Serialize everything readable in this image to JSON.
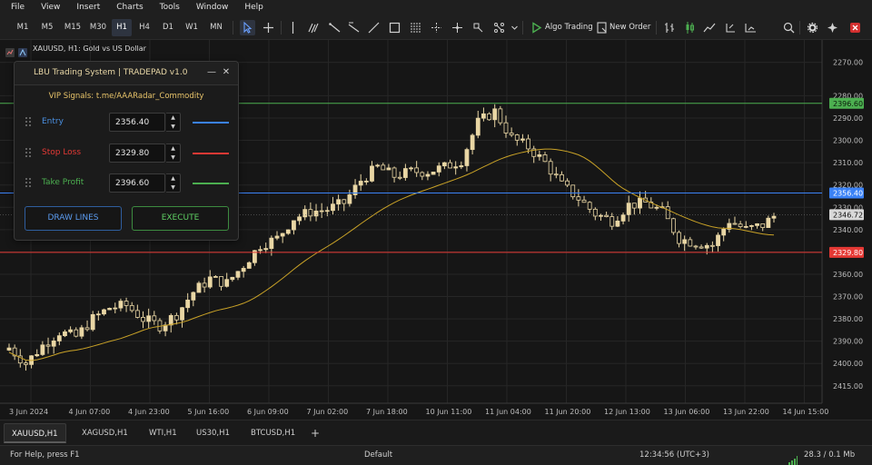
{
  "menu": [
    "File",
    "View",
    "Insert",
    "Charts",
    "Tools",
    "Window",
    "Help"
  ],
  "toolbar": {
    "timeframes": [
      "M1",
      "M5",
      "M15",
      "M30",
      "H1",
      "H4",
      "D1",
      "W1",
      "MN"
    ],
    "active_timeframe": "H1",
    "algo_trading": "Algo Trading",
    "new_order": "New Order"
  },
  "chart": {
    "symbol_title": "XAUUSD, H1:  Gold vs US Dollar",
    "y_ticks": [
      "2415.00",
      "2400.00",
      "2390.00",
      "2380.00",
      "2370.00",
      "2360.00",
      "2350.00",
      "2340.00",
      "2330.00",
      "2320.00",
      "2310.00",
      "2300.00",
      "2290.00",
      "2280.00",
      "2270.00"
    ],
    "x_ticks": [
      "3 Jun 2024",
      "4 Jun 07:00",
      "4 Jun 23:00",
      "5 Jun 16:00",
      "6 Jun 09:00",
      "7 Jun 02:00",
      "7 Jun 18:00",
      "10 Jun 11:00",
      "11 Jun 04:00",
      "11 Jun 20:00",
      "12 Jun 13:00",
      "13 Jun 06:00",
      "13 Jun 22:00",
      "14 Jun 15:00"
    ],
    "take_profit_label": "2396.60",
    "entry_label": "2356.40",
    "stop_loss_label": "2329.80",
    "current_price_label": "2346.72",
    "colors": {
      "entry": "#3b82f6",
      "stop_loss": "#e53935",
      "take_profit": "#4caf50",
      "candle": "#e9d6a4",
      "ma": "#c9a227"
    }
  },
  "chart_data": {
    "type": "candlestick",
    "symbol": "XAUUSD",
    "timeframe": "H1",
    "ylim": [
      2263,
      2425
    ],
    "y_ticks": [
      2270,
      2280,
      2290,
      2300,
      2310,
      2320,
      2330,
      2340,
      2350,
      2360,
      2370,
      2380,
      2390,
      2400,
      2415
    ],
    "x_tick_labels": [
      "3 Jun 2024",
      "4 Jun 07:00",
      "4 Jun 23:00",
      "5 Jun 16:00",
      "6 Jun 09:00",
      "7 Jun 02:00",
      "7 Jun 18:00",
      "10 Jun 11:00",
      "11 Jun 04:00",
      "11 Jun 20:00",
      "12 Jun 13:00",
      "13 Jun 06:00",
      "13 Jun 22:00",
      "14 Jun 15:00"
    ],
    "horizontal_lines": [
      {
        "value": 2396.6
      },
      {
        "value": 2356.4
      },
      {
        "value": 2329.8
      }
    ],
    "current_price": 2346.72,
    "close_path": [
      [
        0,
        2287
      ],
      [
        3,
        2280
      ],
      [
        6,
        2288
      ],
      [
        9,
        2294
      ],
      [
        12,
        2292
      ],
      [
        15,
        2300
      ],
      [
        18,
        2305
      ],
      [
        21,
        2306
      ],
      [
        24,
        2300
      ],
      [
        27,
        2297
      ],
      [
        30,
        2302
      ],
      [
        33,
        2312
      ],
      [
        36,
        2318
      ],
      [
        39,
        2316
      ],
      [
        42,
        2324
      ],
      [
        45,
        2333
      ],
      [
        48,
        2336
      ],
      [
        51,
        2345
      ],
      [
        54,
        2348
      ],
      [
        57,
        2349
      ],
      [
        60,
        2352
      ],
      [
        63,
        2362
      ],
      [
        66,
        2368
      ],
      [
        69,
        2364
      ],
      [
        72,
        2366
      ],
      [
        75,
        2366
      ],
      [
        78,
        2368
      ],
      [
        81,
        2371
      ],
      [
        84,
        2388
      ],
      [
        87,
        2393
      ],
      [
        90,
        2381
      ],
      [
        93,
        2377
      ],
      [
        96,
        2370
      ],
      [
        99,
        2360
      ],
      [
        102,
        2354
      ],
      [
        105,
        2347
      ],
      [
        108,
        2344
      ],
      [
        111,
        2351
      ],
      [
        114,
        2352
      ],
      [
        117,
        2348
      ],
      [
        120,
        2336
      ],
      [
        123,
        2334
      ],
      [
        126,
        2333
      ],
      [
        129,
        2344
      ],
      [
        132,
        2340
      ],
      [
        135,
        2342
      ],
      [
        137,
        2346
      ]
    ]
  },
  "tradepad": {
    "title": "LBU Trading System | TRADEPAD v1.0",
    "vip": "VIP Signals: t.me/AAARadar_Commodity",
    "rows": [
      {
        "label": "Entry",
        "value": "2356.40"
      },
      {
        "label": "Stop Loss",
        "value": "2329.80"
      },
      {
        "label": "Take Profit",
        "value": "2396.60"
      }
    ],
    "draw_lines": "DRAW LINES",
    "execute": "EXECUTE"
  },
  "symbol_tabs": [
    "XAUUSD,H1",
    "XAGUSD,H1",
    "WTI,H1",
    "US30,H1",
    "BTCUSD,H1"
  ],
  "add_tab": "+",
  "status": {
    "help": "For Help, press F1",
    "profile": "Default",
    "time": "12:34:56 (UTC+3)",
    "traffic": "28.3 / 0.1 Mb"
  }
}
